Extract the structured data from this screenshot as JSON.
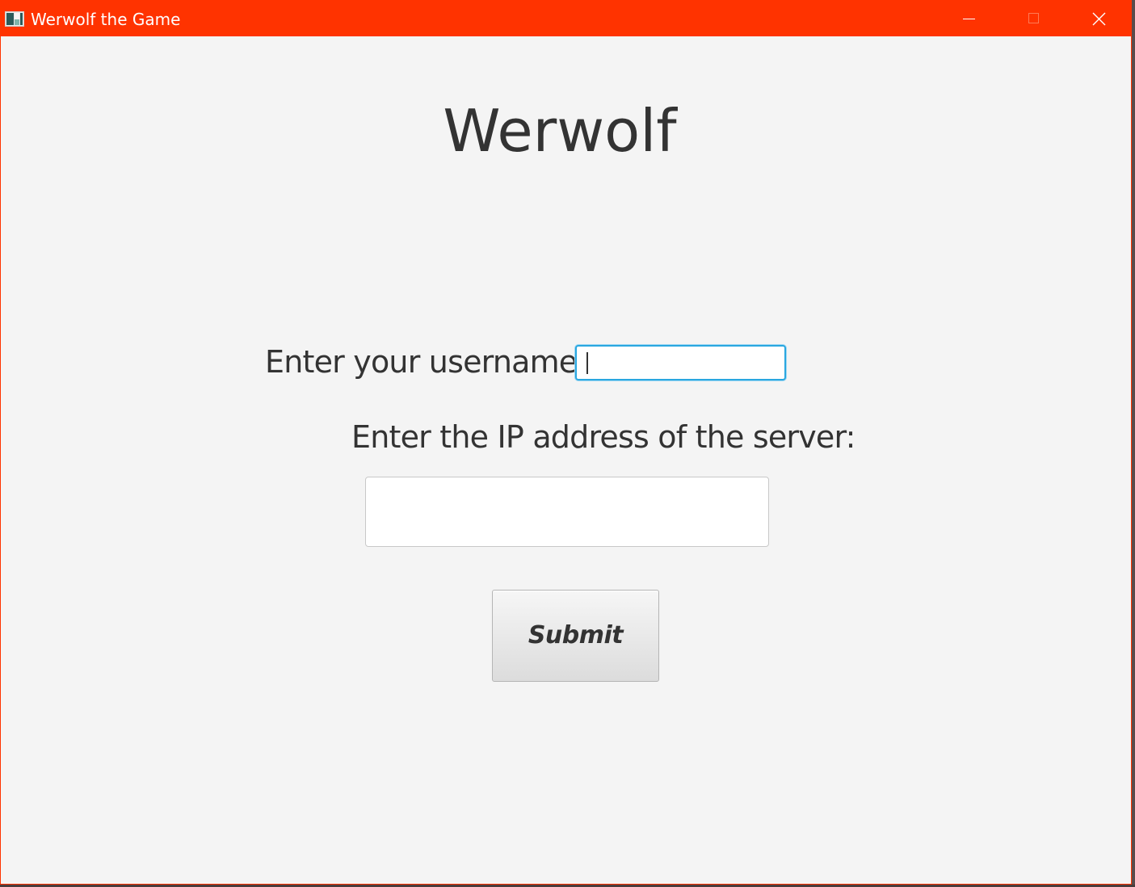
{
  "window": {
    "title": "Werwolf the Game",
    "titlebar_color": "#ff3300",
    "icons": {
      "app": "app-icon",
      "minimize": "minimize-icon",
      "maximize": "maximize-icon",
      "close": "close-icon"
    }
  },
  "main": {
    "heading": "Werwolf",
    "username_label": "Enter your username:",
    "username_value": "",
    "ip_label": "Enter the IP address of the server:",
    "ip_value": "",
    "submit_label": "Submit"
  },
  "colors": {
    "focus_border": "#2aa7e0",
    "text": "#333333",
    "background": "#f4f4f4"
  }
}
